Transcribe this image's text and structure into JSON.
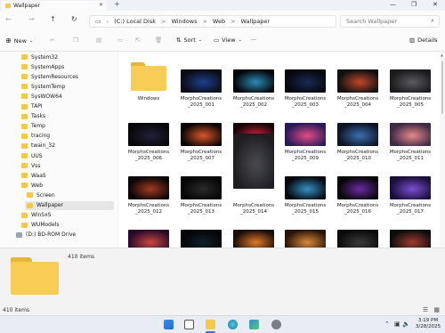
{
  "window": {
    "tab_title": "Wallpaper",
    "new_tab": "+",
    "close_tab": "✕"
  },
  "address": {
    "segments": [
      "(C:) Local Disk",
      "Windows",
      "Web",
      "Wallpaper"
    ],
    "separator": ">",
    "search_placeholder": "Search Wallpaper"
  },
  "toolbar": {
    "new_label": "New",
    "sort_label": "Sort",
    "view_label": "View",
    "more_label": "···",
    "details_label": "Details"
  },
  "sidebar": {
    "items": [
      {
        "label": "System32",
        "kind": "folder",
        "indent": 0
      },
      {
        "label": "SystemApps",
        "kind": "folder",
        "indent": 0
      },
      {
        "label": "SystemResources",
        "kind": "folder",
        "indent": 0
      },
      {
        "label": "SystemTemp",
        "kind": "folder",
        "indent": 0
      },
      {
        "label": "SysWOW64",
        "kind": "folder",
        "indent": 0
      },
      {
        "label": "TAPI",
        "kind": "folder",
        "indent": 0
      },
      {
        "label": "Tasks",
        "kind": "folder",
        "indent": 0
      },
      {
        "label": "Temp",
        "kind": "folder",
        "indent": 0
      },
      {
        "label": "tracing",
        "kind": "folder",
        "indent": 0
      },
      {
        "label": "twain_32",
        "kind": "folder",
        "indent": 0
      },
      {
        "label": "UUS",
        "kind": "folder",
        "indent": 0
      },
      {
        "label": "Vss",
        "kind": "folder",
        "indent": 0
      },
      {
        "label": "WaaS",
        "kind": "folder",
        "indent": 0
      },
      {
        "label": "Web",
        "kind": "folder",
        "indent": 0
      },
      {
        "label": "Screen",
        "kind": "folder",
        "indent": 1
      },
      {
        "label": "Wallpaper",
        "kind": "folder",
        "indent": 1,
        "selected": true
      },
      {
        "label": "WinSxS",
        "kind": "folder",
        "indent": 0
      },
      {
        "label": "WUModels",
        "kind": "folder",
        "indent": 0
      },
      {
        "label": "(D:) BD-ROM Drive",
        "kind": "drive",
        "indent": -1
      }
    ]
  },
  "files": [
    {
      "name": "Windows",
      "kind": "folder"
    },
    {
      "name": "MorphsCreations_2025_001",
      "kind": "image",
      "colors": [
        "#0b0b14",
        "#1d3f8a"
      ]
    },
    {
      "name": "MorphsCreations_2025_002",
      "kind": "image",
      "colors": [
        "#050508",
        "#2b8ab5"
      ]
    },
    {
      "name": "MorphsCreations_2025_003",
      "kind": "image",
      "colors": [
        "#06060c",
        "#1a2a55"
      ]
    },
    {
      "name": "MorphsCreations_2025_004",
      "kind": "image",
      "colors": [
        "#101010",
        "#c0482a"
      ]
    },
    {
      "name": "MorphsCreations_2025_005",
      "kind": "image",
      "colors": [
        "#1b1b1e",
        "#5a5a60"
      ]
    },
    {
      "name": "MorphsCreations_2025_006",
      "kind": "image",
      "colors": [
        "#08080a",
        "#20203a"
      ]
    },
    {
      "name": "MorphsCreations_2025_007",
      "kind": "image",
      "colors": [
        "#0a0505",
        "#d8562a"
      ]
    },
    {
      "name": "MorphsCreations_2025_008",
      "kind": "image",
      "colors": [
        "#160608",
        "#d0203a"
      ]
    },
    {
      "name": "MorphsCreations_2025_009",
      "kind": "image",
      "colors": [
        "#2a1a5a",
        "#e44c86"
      ]
    },
    {
      "name": "MorphsCreations_2025_010",
      "kind": "image",
      "colors": [
        "#0d1424",
        "#3b6fae"
      ]
    },
    {
      "name": "MorphsCreations_2025_011",
      "kind": "image",
      "colors": [
        "#3d2a44",
        "#e78a8a"
      ]
    },
    {
      "name": "MorphsCreations_2025_012",
      "kind": "image",
      "colors": [
        "#070506",
        "#a33a20"
      ]
    },
    {
      "name": "MorphsCreations_2025_013",
      "kind": "image",
      "colors": [
        "#040404",
        "#2a2a2a"
      ]
    },
    {
      "name": "MorphsCreations_2025_014",
      "kind": "image",
      "colors": [
        "#1e1e22",
        "#4a4a52"
      ]
    },
    {
      "name": "MorphsCreations_2025_015",
      "kind": "image",
      "colors": [
        "#05060c",
        "#3490c4"
      ]
    },
    {
      "name": "MorphsCreations_2025_016",
      "kind": "image",
      "colors": [
        "#050505",
        "#6a2ca0"
      ]
    },
    {
      "name": "MorphsCreations_2025_017",
      "kind": "image",
      "colors": [
        "#1a0f3a",
        "#7b4fd3"
      ]
    },
    {
      "name": "",
      "kind": "image",
      "colors": [
        "#2a0a2a",
        "#c8463e"
      ]
    },
    {
      "name": "",
      "kind": "image",
      "colors": [
        "#040404",
        "#12202a"
      ]
    },
    {
      "name": "",
      "kind": "image",
      "colors": [
        "#1a0c08",
        "#e07a2a"
      ]
    },
    {
      "name": "",
      "kind": "image",
      "colors": [
        "#2a1408",
        "#d88a3a"
      ]
    },
    {
      "name": "",
      "kind": "image",
      "colors": [
        "#0a0a0a",
        "#3a3a3a"
      ]
    },
    {
      "name": "",
      "kind": "image",
      "colors": [
        "#0c0c0c",
        "#a03a30"
      ]
    }
  ],
  "details_pane": {
    "item_count": "410 items"
  },
  "status": {
    "item_count": "410 items"
  },
  "taskbar": {
    "time": "3:19 PM",
    "date": "3/28/2025"
  }
}
